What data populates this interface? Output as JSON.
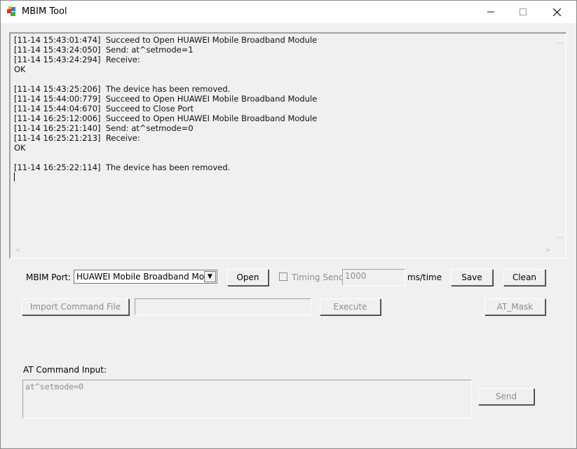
{
  "window": {
    "title": "MBIM Tool"
  },
  "log": {
    "lines": [
      "[11-14 15:43:01:474]  Succeed to Open HUAWEI Mobile Broadband Module",
      "[11-14 15:43:24:050]  Send: at^setmode=1",
      "[11-14 15:43:24:294]  Receive:",
      "OK",
      "",
      "[11-14 15:43:25:206]  The device has been removed.",
      "[11-14 15:44:00:779]  Succeed to Open HUAWEI Mobile Broadband Module",
      "[11-14 15:44:04:670]  Succeed to Close Port",
      "[11-14 16:25:12:006]  Succeed to Open HUAWEI Mobile Broadband Module",
      "[11-14 16:25:21:140]  Send: at^setmode=0",
      "[11-14 16:25:21:213]  Receive:",
      "OK",
      "",
      "[11-14 16:25:22:114]  The device has been removed."
    ]
  },
  "port": {
    "label": "MBIM Port:",
    "selected": "HUAWEI Mobile Broadband Module",
    "open_label": "Open"
  },
  "timing": {
    "label": "Timing Send",
    "checked": false,
    "value": "1000",
    "unit": "ms/time"
  },
  "toolbar": {
    "save_label": "Save",
    "clean_label": "Clean",
    "import_label": "Import Command File",
    "import_path": "",
    "execute_label": "Execute",
    "atmask_label": "AT_Mask"
  },
  "at_input": {
    "label": "AT Command Input:",
    "value": "at^setmode=0",
    "send_label": "Send"
  },
  "colors": {
    "disabled_text": "#8d8d8d",
    "background": "#f0f0f0"
  }
}
